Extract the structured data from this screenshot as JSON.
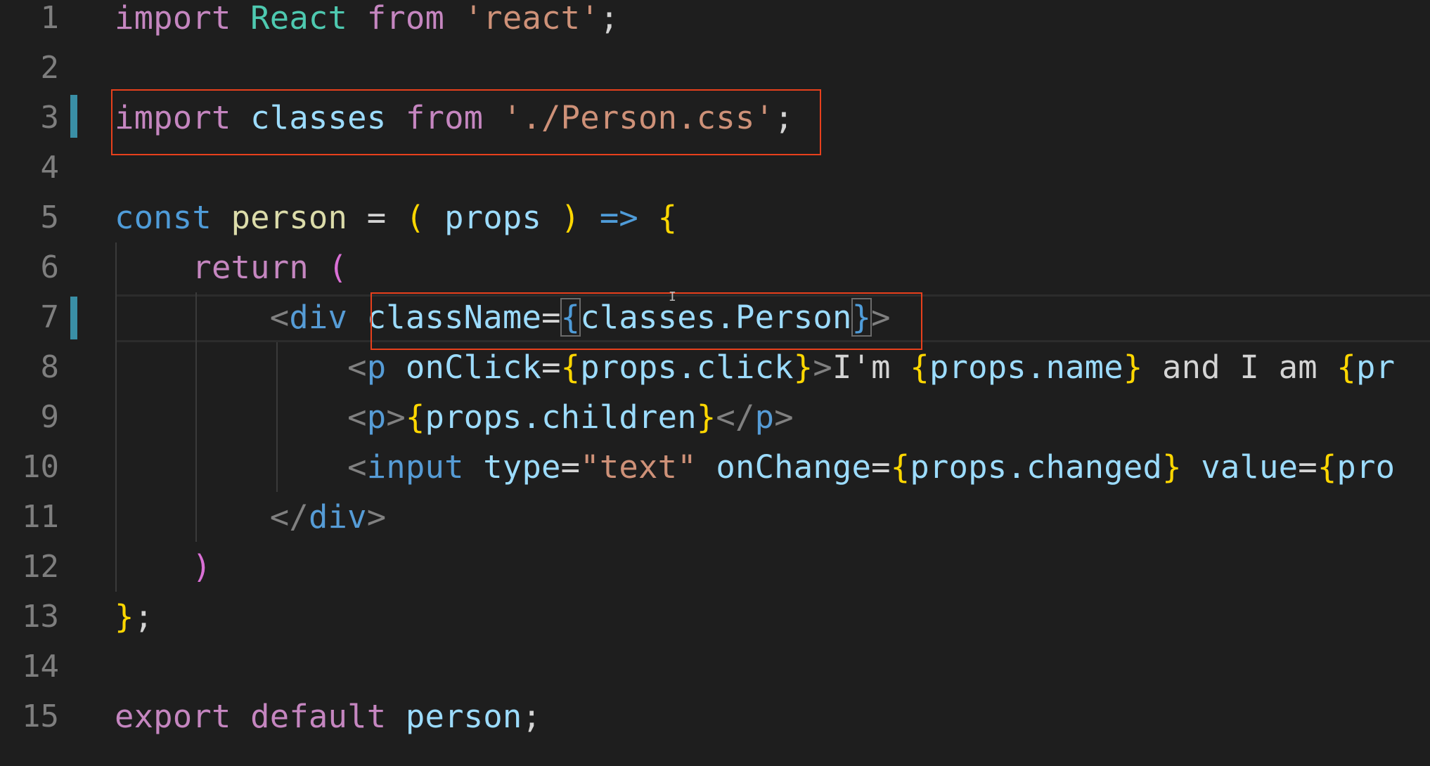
{
  "editor": {
    "line_numbers": [
      "1",
      "2",
      "3",
      "4",
      "5",
      "6",
      "7",
      "8",
      "9",
      "10",
      "11",
      "12",
      "13",
      "14",
      "15"
    ],
    "lines": {
      "l1": {
        "import": "import",
        "react_ident": "React",
        "from": "from",
        "module": "'react'",
        "semi": ";"
      },
      "l3": {
        "import": "import",
        "classes_ident": "classes",
        "from": "from",
        "module": "'./Person.css'",
        "semi": ";"
      },
      "l5": {
        "const": "const",
        "name": "person",
        "eq": "=",
        "open_paren": "(",
        "param": "props",
        "close_paren": ")",
        "arrow": "=>",
        "open_brace": "{"
      },
      "l6": {
        "return": "return",
        "open_paren": "("
      },
      "l7": {
        "lt": "<",
        "tag": "div",
        "attr": "className",
        "eq": "=",
        "open_brace": "{",
        "expr": "classes.Person",
        "close_brace": "}",
        "gt": ">"
      },
      "l8": {
        "lt": "<",
        "tag": "p",
        "attr": "onClick",
        "eq": "=",
        "open_brace": "{",
        "expr": "props.click",
        "close_brace": "}",
        "gt": ">",
        "text1": "I'm ",
        "open_brace2": "{",
        "expr2": "props.name",
        "close_brace2": "}",
        "text2": " and I am ",
        "open_brace3": "{",
        "expr3": "pr"
      },
      "l9": {
        "lt": "<",
        "tag": "p",
        "gt": ">",
        "open_brace": "{",
        "expr": "props.children",
        "close_brace": "}",
        "close_lt": "</",
        "close_tag": "p",
        "close_gt": ">"
      },
      "l10": {
        "lt": "<",
        "tag": "input",
        "attr1": "type",
        "eq1": "=",
        "val1": "\"text\"",
        "attr2": "onChange",
        "eq2": "=",
        "open_brace": "{",
        "expr": "props.changed",
        "close_brace": "}",
        "attr3": "value",
        "eq3": "=",
        "open_brace2": "{",
        "expr2": "pro"
      },
      "l11": {
        "close_lt": "</",
        "close_tag": "div",
        "close_gt": ">"
      },
      "l12": {
        "close_paren": ")"
      },
      "l13": {
        "close_brace": "}",
        "semi": ";"
      },
      "l15": {
        "export": "export",
        "default": "default",
        "name": "person",
        "semi": ";"
      }
    },
    "cursor_glyph": "I",
    "annotation_color": "#e8401c",
    "modified_line_color": "#3a8fa6"
  }
}
